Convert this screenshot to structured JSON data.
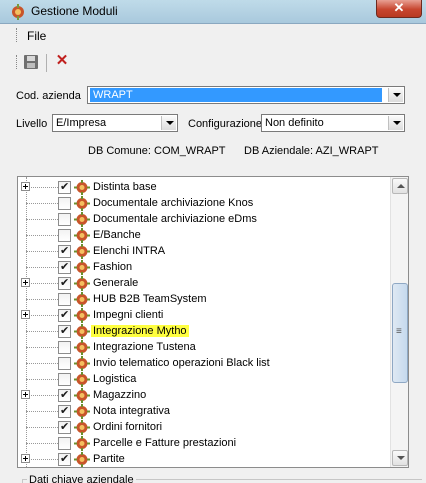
{
  "window": {
    "title": "Gestione Moduli",
    "close_label": "✕"
  },
  "menu": {
    "file": "File"
  },
  "toolbar": {
    "save_icon": "floppy-disk-icon",
    "delete_icon": "red-x-icon",
    "delete_glyph": "✕"
  },
  "form": {
    "cod_azienda_label": "Cod. azienda",
    "cod_azienda_value": "WRAPT",
    "livello_label": "Livello",
    "livello_value": "E/Impresa",
    "configurazione_label": "Configurazione",
    "configurazione_value": "Non definito",
    "db_comune": "DB Comune: COM_WRAPT",
    "db_aziendale": "DB Aziendale: AZI_WRAPT"
  },
  "modules": [
    {
      "label": "Distinta base",
      "checked": true,
      "expandable": true
    },
    {
      "label": "Documentale archiviazione Knos",
      "checked": false,
      "expandable": false
    },
    {
      "label": "Documentale archiviazione eDms",
      "checked": false,
      "expandable": false
    },
    {
      "label": "E/Banche",
      "checked": false,
      "expandable": false
    },
    {
      "label": "Elenchi INTRA",
      "checked": true,
      "expandable": false
    },
    {
      "label": "Fashion",
      "checked": true,
      "expandable": false
    },
    {
      "label": "Generale",
      "checked": true,
      "expandable": true
    },
    {
      "label": "HUB B2B TeamSystem",
      "checked": false,
      "expandable": false
    },
    {
      "label": "Impegni clienti",
      "checked": true,
      "expandable": true
    },
    {
      "label": "Integrazione Mytho",
      "checked": true,
      "expandable": false,
      "highlighted": true
    },
    {
      "label": "Integrazione Tustena",
      "checked": false,
      "expandable": false
    },
    {
      "label": "Invio telematico operazioni Black list",
      "checked": false,
      "expandable": false
    },
    {
      "label": "Logistica",
      "checked": false,
      "expandable": false
    },
    {
      "label": "Magazzino",
      "checked": true,
      "expandable": true
    },
    {
      "label": "Nota integrativa",
      "checked": true,
      "expandable": false
    },
    {
      "label": "Ordini fornitori",
      "checked": true,
      "expandable": false
    },
    {
      "label": "Parcelle e Fatture prestazioni",
      "checked": false,
      "expandable": false
    },
    {
      "label": "Partite",
      "checked": true,
      "expandable": true
    }
  ],
  "groupbox": {
    "title": "Dati chiave aziendale"
  },
  "colors": {
    "highlight": "#ffff40",
    "selection": "#3399ff",
    "close": "#c7462f"
  }
}
